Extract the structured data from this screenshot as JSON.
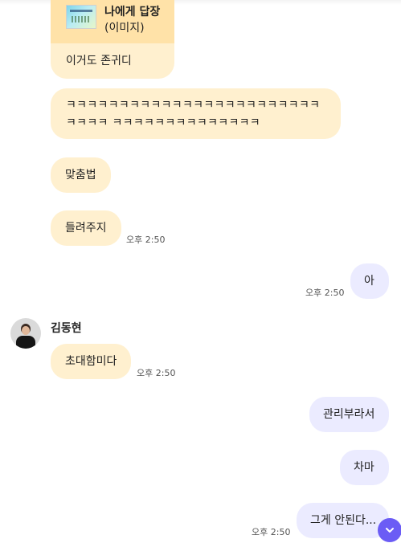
{
  "reply": {
    "title": "나에게 답장",
    "subtitle": "(이미지)",
    "message": "이거도 존귀디"
  },
  "messages": [
    {
      "text": "ㅋㅋㅋㅋㅋㅋㅋㅋㅋㅋㅋㅋㅋㅋㅋㅋㅋㅋㅋㅋㅋㅋㅋㅋㅋㅋㅋㅋ ㅋㅋㅋㅋㅋㅋㅋㅋㅋㅋㅋㅋㅋㅋ"
    },
    {
      "text": "맞춤법"
    },
    {
      "text": "들려주지",
      "time": "오후 2:50"
    },
    {
      "text": "아",
      "time": "오후 2:50"
    },
    {
      "text": "초대함미다",
      "time": "오후 2:50"
    },
    {
      "text": "관리부라서"
    },
    {
      "text": "차마"
    },
    {
      "text": "그게 안된다...",
      "time": "오후 2:50"
    }
  ],
  "sender": {
    "name": "김동현"
  },
  "icons": {
    "scroll_down": "chevron-down-icon",
    "accent": "#6b5cf5"
  }
}
